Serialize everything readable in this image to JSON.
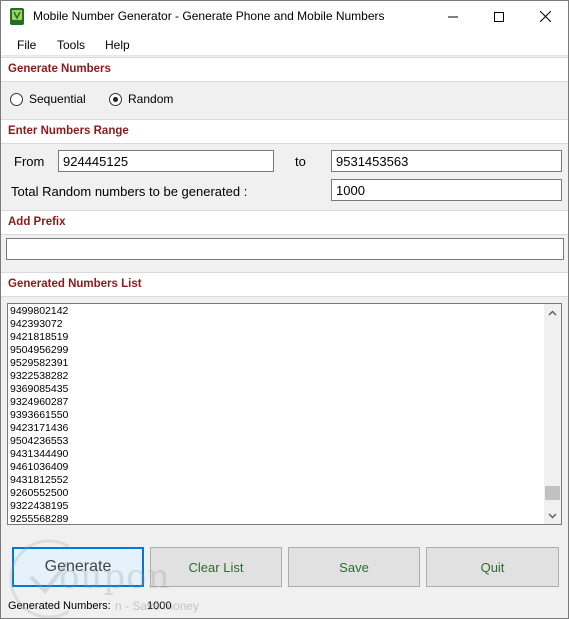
{
  "window": {
    "title": "Mobile Number Generator - Generate Phone and Mobile Numbers"
  },
  "menu": {
    "file": "File",
    "tools": "Tools",
    "help": "Help"
  },
  "sections": {
    "generate": "Generate Numbers",
    "range": "Enter Numbers Range",
    "prefix": "Add Prefix",
    "list": "Generated Numbers List"
  },
  "mode": {
    "sequential": "Sequential",
    "random": "Random",
    "selected": "random"
  },
  "range": {
    "from_label": "From",
    "from_value": "924445125",
    "to_label": "to",
    "to_value": "9531453563",
    "total_label": "Total Random numbers to be generated :",
    "total_value": "1000"
  },
  "prefix": {
    "value": ""
  },
  "numbers": [
    "9499802142",
    "942393072",
    "9421818519",
    "9504956299",
    "9529582391",
    "9322538282",
    "9369085435",
    "9324960287",
    "9393661550",
    "9423171436",
    "9504236553",
    "9431344490",
    "9461036409",
    "9431812552",
    "9260552500",
    "9322438195",
    "9255568289"
  ],
  "scroll": {
    "position_fraction": 0.96,
    "visible_fraction": 0.07
  },
  "buttons": {
    "generate": "Generate",
    "clear": "Clear List",
    "save": "Save",
    "quit": "Quit"
  },
  "status": {
    "label": "Generated Numbers:",
    "value": "1000"
  },
  "watermark": {
    "logo": "oupon",
    "sub": "n - Save money"
  },
  "colors": {
    "section_title": "#8b1a1a",
    "button_text": "#2f6b2f",
    "focus_border": "#0078d7"
  }
}
